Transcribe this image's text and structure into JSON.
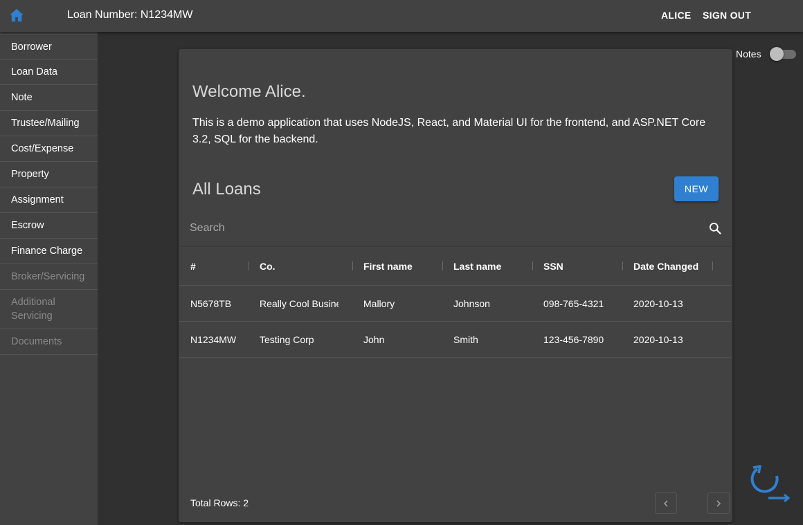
{
  "header": {
    "loan_title": "Loan Number: N1234MW",
    "user_label": "ALICE",
    "signout_label": "SIGN OUT"
  },
  "sidebar": {
    "items": [
      {
        "label": "Borrower"
      },
      {
        "label": "Loan Data"
      },
      {
        "label": "Note"
      },
      {
        "label": "Trustee/Mailing"
      },
      {
        "label": "Cost/Expense"
      },
      {
        "label": "Property"
      },
      {
        "label": "Assignment"
      },
      {
        "label": "Escrow"
      },
      {
        "label": "Finance Charge"
      },
      {
        "label": "Broker/Servicing"
      },
      {
        "label": "Additional Servicing"
      },
      {
        "label": "Documents"
      }
    ]
  },
  "notes": {
    "label": "Notes",
    "enabled": false
  },
  "main": {
    "welcome": "Welcome Alice.",
    "intro": "This is a demo application that uses NodeJS, React, and Material UI for the frontend, and ASP.NET Core 3.2, SQL for the backend.",
    "section_title": "All Loans",
    "new_button": "NEW",
    "search_placeholder": "Search"
  },
  "table": {
    "columns": [
      "#",
      "Co.",
      "First name",
      "Last name",
      "SSN",
      "Date Changed"
    ],
    "rows": [
      [
        "N5678TB",
        "Really Cool Business",
        "Mallory",
        "Johnson",
        "098-765-4321",
        "2020-10-13"
      ],
      [
        "N1234MW",
        "Testing Corp",
        "John",
        "Smith",
        "123-456-7890",
        "2020-10-13"
      ]
    ],
    "total_rows": "Total Rows: 2"
  },
  "colors": {
    "accent": "#2f80d1",
    "background": "#303030",
    "surface": "#424242"
  }
}
